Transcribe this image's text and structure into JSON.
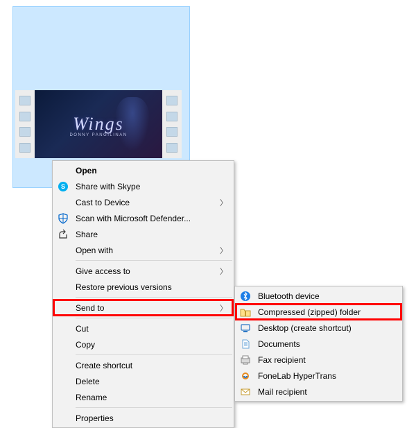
{
  "video": {
    "title": "Wings",
    "subtitle": "DONNY PANGILINAN"
  },
  "contextMenu": {
    "open": "Open",
    "shareSkype": "Share with Skype",
    "castToDevice": "Cast to Device",
    "scanDefender": "Scan with Microsoft Defender...",
    "share": "Share",
    "openWith": "Open with",
    "giveAccess": "Give access to",
    "restorePrev": "Restore previous versions",
    "sendTo": "Send to",
    "cut": "Cut",
    "copy": "Copy",
    "createShortcut": "Create shortcut",
    "delete": "Delete",
    "rename": "Rename",
    "properties": "Properties"
  },
  "sendToMenu": {
    "bluetooth": "Bluetooth device",
    "compressed": "Compressed (zipped) folder",
    "desktop": "Desktop (create shortcut)",
    "documents": "Documents",
    "fax": "Fax recipient",
    "fonelab": "FoneLab HyperTrans",
    "mail": "Mail recipient"
  }
}
